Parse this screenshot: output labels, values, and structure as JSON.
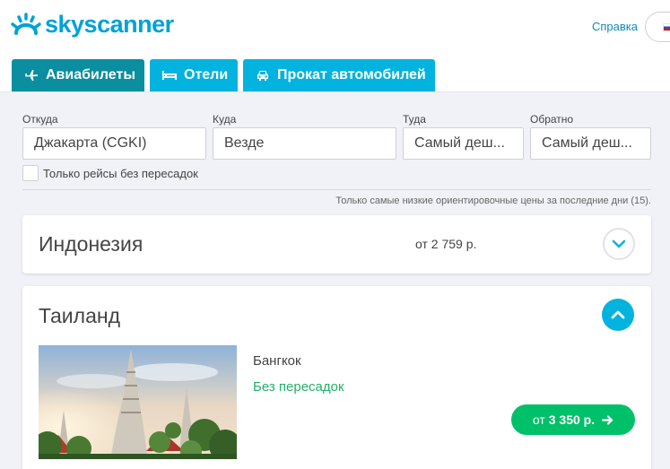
{
  "header": {
    "brand": "skyscanner",
    "help_label": "Справка",
    "brand_color": "#00a2d6"
  },
  "tabs": [
    {
      "label": "Авиабилеты",
      "icon": "plane-icon",
      "active": true
    },
    {
      "label": "Отели",
      "icon": "bed-icon",
      "active": false
    },
    {
      "label": "Прокат автомобилей",
      "icon": "car-icon",
      "active": false
    }
  ],
  "search": {
    "from_label": "Откуда",
    "from_value": "Джакарта (CGKI)",
    "to_label": "Куда",
    "to_value": "Везде",
    "depart_label": "Туда",
    "depart_value": "Самый деш...",
    "return_label": "Обратно",
    "return_value": "Самый деш...",
    "direct_only_label": "Только рейсы без пересадок",
    "direct_only_checked": false
  },
  "note": "Только самые низкие ориентировочные цены за последние дни (15).",
  "results": [
    {
      "country": "Индонезия",
      "price": "от 2 759 р.",
      "expanded": false
    },
    {
      "country": "Таиланд",
      "expanded": true,
      "city": "Бангкок",
      "stops": "Без пересадок",
      "price_from": "от",
      "price_amount": "3 350 р."
    }
  ],
  "colors": {
    "tab": "#02b3df",
    "tab_active": "#0a8ea0",
    "price_button": "#00c16a",
    "direct_text": "#23b06b"
  }
}
